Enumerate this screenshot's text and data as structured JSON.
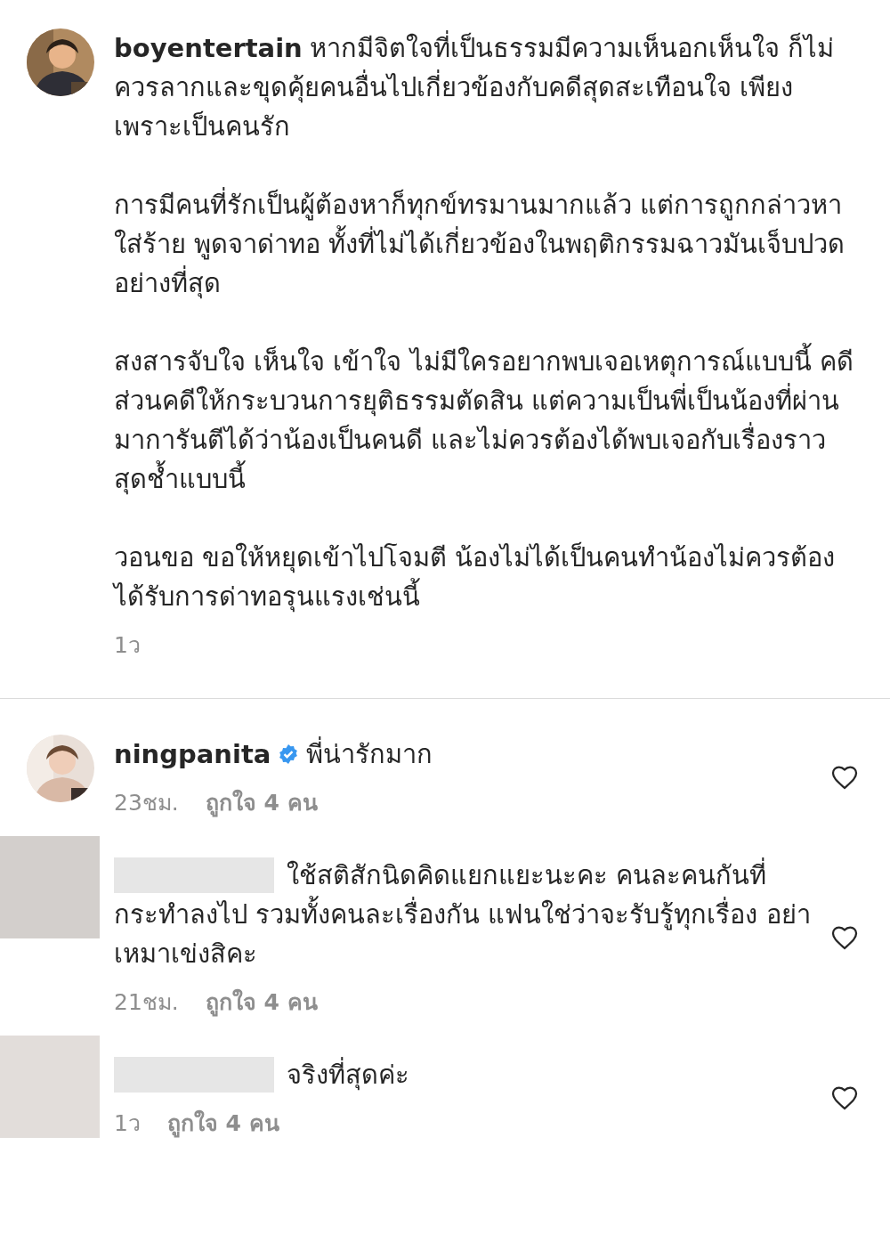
{
  "comments": [
    {
      "kind": "caption",
      "username": "boyentertain",
      "verified": false,
      "name_redacted": false,
      "text": "หากมีจิตใจที่เป็นธรรมมีความเห็นอกเห็นใจ ก็ไม่ควรลากและขุดคุ้ยคนอื่นไปเกี่ยวข้องกับคดีสุดสะเทือนใจ เพียงเพราะเป็นคนรัก\n\nการมีคนที่รักเป็นผู้ต้องหาก็ทุกข์ทรมานมากแล้ว แต่การถูกกล่าวหาใส่ร้าย พูดจาด่าทอ ทั้งที่ไม่ได้เกี่ยวข้องในพฤติกรรมฉาวมันเจ็บปวดอย่างที่สุด\n\nสงสารจับใจ เห็นใจ เข้าใจ ไม่มีใครอยากพบเจอเหตุการณ์แบบนี้ คดีส่วนคดีให้กระบวนการยุติธรรมตัดสิน แต่ความเป็นพี่เป็นน้องที่ผ่านมาการันตีได้ว่าน้องเป็นคนดี และไม่ควรต้องได้พบเจอกับเรื่องราวสุดช้ำแบบนี้\n\nวอนขอ ขอให้หยุดเข้าไปโจมตี น้องไม่ได้เป็นคนทำน้องไม่ควรต้องได้รับการด่าทอรุนแรงเช่นนี้",
      "time": "1ว"
    },
    {
      "kind": "comment",
      "username": "ningpanita",
      "verified": true,
      "name_redacted": false,
      "text": "พี่น่ารักมาก",
      "time": "23ชม.",
      "likes": "ถูกใจ 4 คน"
    },
    {
      "kind": "comment",
      "name_redacted": true,
      "verified": false,
      "text": "ใช้สติสักนิดคิดแยกแยะนะคะ คนละคนกันที่กระทำลงไป รวมทั้งคนละเรื่องกัน แฟนใช่ว่าจะรับรู้ทุกเรื่อง อย่าเหมาเข่งสิคะ",
      "time": "21ชม.",
      "likes": "ถูกใจ 4 คน"
    },
    {
      "kind": "comment",
      "name_redacted": true,
      "verified": false,
      "text": "จริงที่สุดค่ะ",
      "time": "1ว",
      "likes": "ถูกใจ 4 คน"
    }
  ]
}
